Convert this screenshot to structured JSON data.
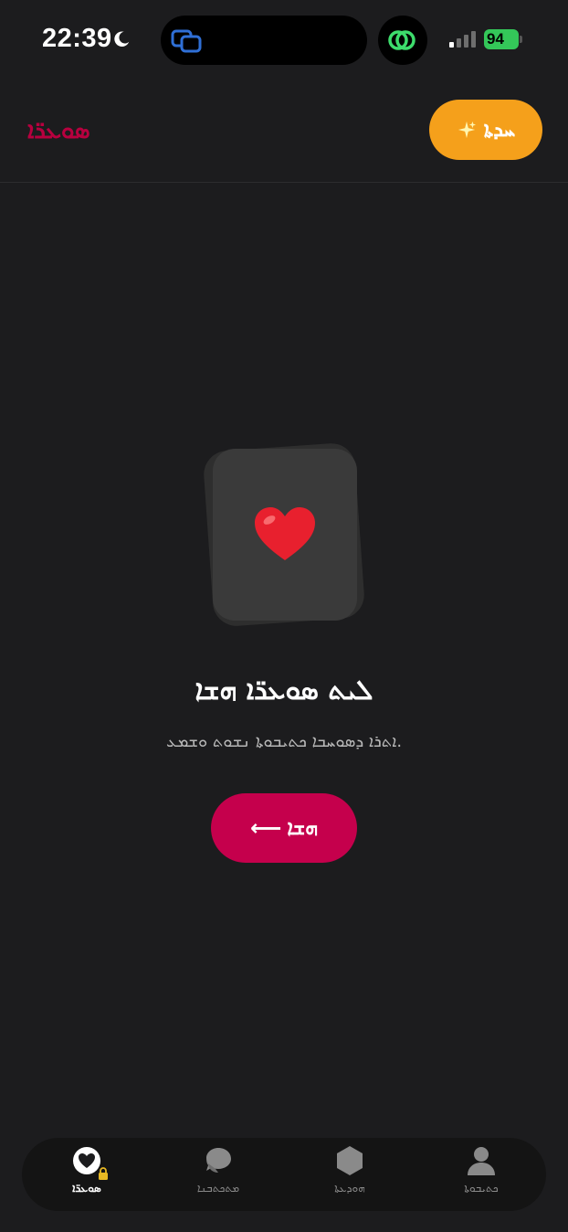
{
  "status_bar": {
    "time": "22:39",
    "battery": "94"
  },
  "header": {
    "title": "ܣܘܥܪ̈ܐ",
    "new_button_label": "ܚܕܬܐ"
  },
  "empty_state": {
    "title": "ܠܝܬ ܣܘܥܪ̈ܐ ܗܫܐ",
    "subtitle": "ܐܬܪܐ ܕܣܘܚܒܐ ܟܬܝܒܘܬܐ ܢܫܘܬ ܘܫܡܥ.",
    "action_label": "ܗܫܐ"
  },
  "tabs": [
    {
      "label": "ܣܘܥܪ̈ܐ",
      "icon": "heart-icon",
      "active": true,
      "locked": true
    },
    {
      "label": "ܡܬܟܬܒܢܐ",
      "icon": "chat-icon",
      "active": false
    },
    {
      "label": "ܗܘܕܥܬܐ",
      "icon": "hexagon-icon",
      "active": false
    },
    {
      "label": "ܟܬܝܒܘܬܐ",
      "icon": "person-icon",
      "active": false
    }
  ],
  "colors": {
    "accent": "#c5004c",
    "header_title": "#b8003f",
    "new_button": "#f5a01b",
    "background": "#1c1c1e"
  }
}
